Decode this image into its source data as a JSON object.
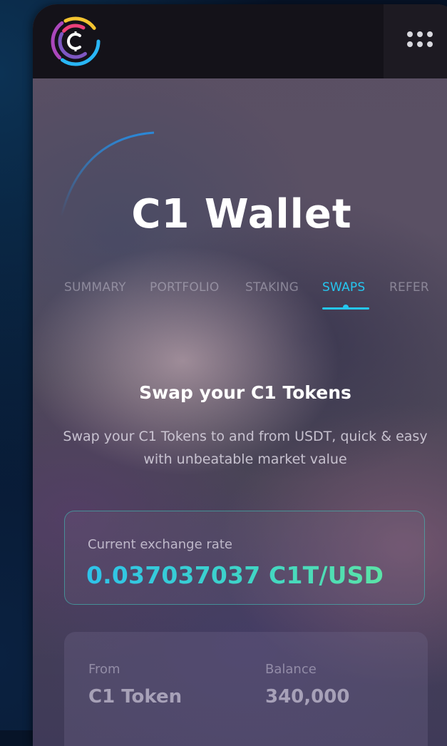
{
  "app": {
    "title": "C1 Wallet",
    "logo_icon": "c1-logo-icon",
    "menu_icon": "grid-dots-icon"
  },
  "tabs": [
    {
      "label": "SUMMARY",
      "active": false
    },
    {
      "label": "PORTFOLIO",
      "active": false
    },
    {
      "label": "STAKING",
      "active": false
    },
    {
      "label": "SWAPS",
      "active": true
    },
    {
      "label": "REFER",
      "active": false
    }
  ],
  "swap": {
    "title": "Swap your C1 Tokens",
    "description": "Swap your C1 Tokens to and from USDT, quick & easy with unbeatable market value"
  },
  "rate": {
    "label": "Current exchange rate",
    "value": "0.037037037 C1T/USD"
  },
  "form": {
    "from_label": "From",
    "from_value": "C1 Token",
    "balance_label": "Balance",
    "balance_value": "340,000"
  },
  "colors": {
    "accent": "#25c7f0",
    "rate_gradient_start": "#2ec3ea",
    "rate_gradient_end": "#5be3a7",
    "topbar": "#141219"
  }
}
